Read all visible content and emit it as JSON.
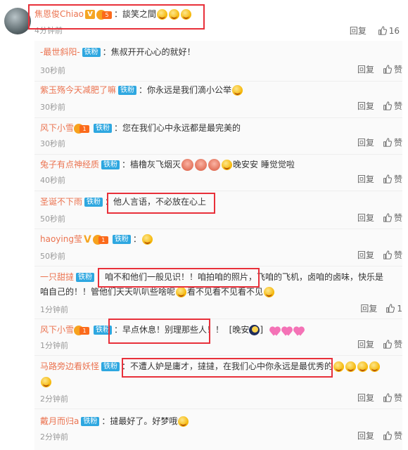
{
  "main_comment": {
    "user": "焦恩俊Chiao",
    "badge_v": "V",
    "crown_level": "5",
    "text": "：談笑之間",
    "time": "4分钟前",
    "reply_label": "回复",
    "like_count": "16"
  },
  "colors": {
    "username": "#eb7350",
    "fan_badge": "#2ea7e0",
    "highlight_box": "#e8303a",
    "time": "#999999"
  },
  "replies": [
    {
      "user": "-最世斜阳-",
      "fan": "铁粉",
      "text": "：焦叔开开心心的就好！",
      "time": "30秒前",
      "reply_label": "回复",
      "like_label": "赞"
    },
    {
      "user": "紫玉殇今天减肥了嘛",
      "fan": "铁粉",
      "text": "：你永远是我们滴小公举",
      "time": "30秒前",
      "reply_label": "回复",
      "like_label": "赞"
    },
    {
      "user": "风下小雪",
      "fan": "铁粉",
      "text": "：您在我们心中永远都是最完美的",
      "time": "30秒前",
      "reply_label": "回复",
      "like_label": "赞"
    },
    {
      "user": "兔子有点神经质",
      "fan": "铁粉",
      "text": "：樯橹灰飞烟灭",
      "text2": "晚安安 睡觉觉啦",
      "time": "40秒前",
      "reply_label": "回复",
      "like_label": "赞"
    },
    {
      "user": "圣诞不下雨",
      "fan": "铁粉",
      "text": "：他人言语，不必放在心上",
      "time": "50秒前",
      "reply_label": "回复",
      "like_label": "赞"
    },
    {
      "user": "haoying莹",
      "fan": "铁粉",
      "text": "：",
      "time": "50秒前",
      "reply_label": "回复",
      "like_label": "赞"
    },
    {
      "user": "一只甜撻",
      "fan": "铁粉",
      "text": "：咱不和他们一般见识！！咱拍咱的照片，飞咱的飞机，卤咱的卤味，快乐是",
      "text2": "咱自己的！！管他们天天叭叭些啥呢",
      "text3": "看不见看不见看不见",
      "time": "1分钟前",
      "reply_label": "回复",
      "like_count": "1"
    },
    {
      "user": "风下小雪",
      "fan": "铁粉",
      "text": "：早点休息！别理那些人！！",
      "text2": "[晚安",
      "text3": "]",
      "time": "1分钟前",
      "reply_label": "回复",
      "like_label": "赞"
    },
    {
      "user": "马路旁边看妖怪",
      "fan": "铁粉",
      "text": "：不遭人妒是庸才，撻撻，在我们心中你永远是最优秀的",
      "time": "2分钟前",
      "reply_label": "回复",
      "like_label": "赞"
    },
    {
      "user": "戴月而归a",
      "fan": "铁粉",
      "text": "：撻最好了。好梦哦",
      "time": "2分钟前",
      "reply_label": "回复",
      "like_label": "赞"
    }
  ]
}
